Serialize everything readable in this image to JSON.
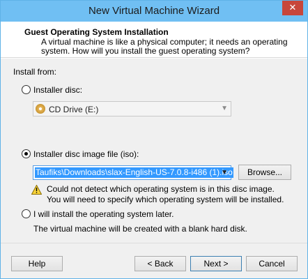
{
  "window": {
    "title": "New Virtual Machine Wizard",
    "close_glyph": "✕"
  },
  "header": {
    "title": "Guest Operating System Installation",
    "description": "A virtual machine is like a physical computer; it needs an operating system. How will you install the guest operating system?"
  },
  "install_from": {
    "label": "Install from:",
    "installer_disc": {
      "label": "Installer disc:",
      "selected": false
    },
    "cd_drive": {
      "value": "CD Drive (E:)",
      "icon": "cd-drive-icon"
    },
    "iso": {
      "label": "Installer disc image file (iso):",
      "selected": true,
      "path": "Taufiks\\Downloads\\slax-English-US-7.0.8-i486 (1).iso",
      "browse_label": "Browse..."
    },
    "warning": {
      "icon": "warning-icon",
      "line1": "Could not detect which operating system is in this disc image.",
      "line2": "You will need to specify which operating system will be installed."
    },
    "later": {
      "label": "I will install the operating system later.",
      "selected": false,
      "note": "The virtual machine will be created with a blank hard disk."
    }
  },
  "buttons": {
    "help": "Help",
    "back": "< Back",
    "next": "Next >",
    "cancel": "Cancel"
  },
  "colors": {
    "titlebar": "#70bff3",
    "close": "#c7463b",
    "selection": "#3399ff"
  }
}
